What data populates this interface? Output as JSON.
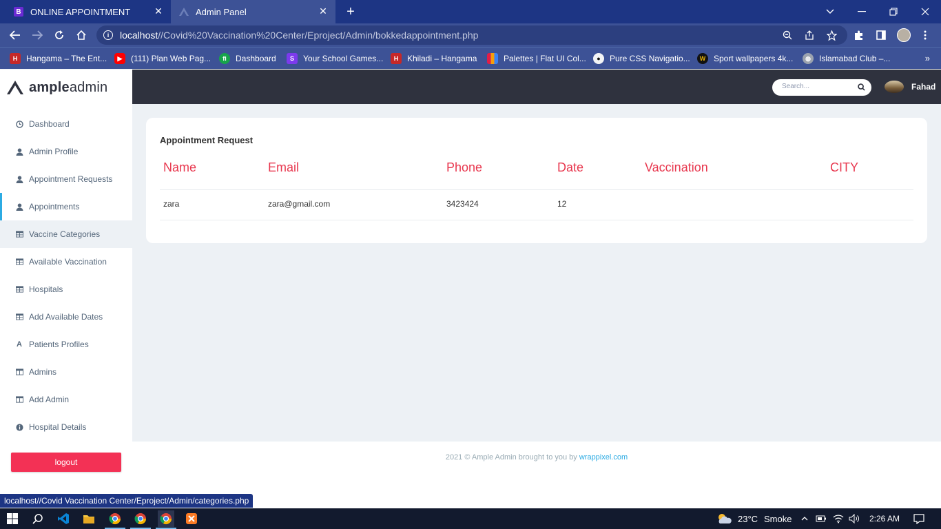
{
  "browser": {
    "tabs": [
      {
        "title": "ONLINE APPOINTMENT",
        "favicon": "B"
      },
      {
        "title": "Admin Panel"
      }
    ],
    "url_host": "localhost",
    "url_path": "//Covid%20Vaccination%20Center/Eproject/Admin/bokkedappointment.php",
    "bookmarks": [
      {
        "label": "Hangama – The Ent...",
        "icon": "hangama-icon",
        "color": "#c62828"
      },
      {
        "label": "(111) Plan Web Pag...",
        "icon": "youtube-icon",
        "color": "#ff0000"
      },
      {
        "label": "Dashboard",
        "icon": "fi-icon",
        "color": "#16a34a"
      },
      {
        "label": "Your School Games...",
        "icon": "school-games-icon",
        "color": "#7c3aed"
      },
      {
        "label": "Khiladi – Hangama",
        "icon": "hangama-icon",
        "color": "#c62828"
      },
      {
        "label": "Palettes | Flat UI Col...",
        "icon": "palette-icon",
        "color": "#e11d48"
      },
      {
        "label": "Pure CSS Navigatio...",
        "icon": "css-icon",
        "color": "#f3f4f6"
      },
      {
        "label": "Sport wallpapers 4k...",
        "icon": "wallpaper-icon",
        "color": "#eab308"
      },
      {
        "label": "Islamabad Club –...",
        "icon": "globe-icon",
        "color": "#9ca3af"
      }
    ],
    "status_url": "localhost//Covid Vaccination Center/Eproject/Admin/categories.php"
  },
  "app": {
    "logo_bold": "ample",
    "logo_light": "admin",
    "search_placeholder": "Search...",
    "user_name": "Fahad",
    "nav": [
      {
        "label": "Dashboard",
        "icon": "clock-icon"
      },
      {
        "label": "Admin Profile",
        "icon": "user-icon"
      },
      {
        "label": "Appointment Requests",
        "icon": "user-icon"
      },
      {
        "label": "Appointments",
        "icon": "user-icon",
        "active": true
      },
      {
        "label": "Vaccine Categories",
        "icon": "table-icon",
        "hover": true
      },
      {
        "label": "Available Vaccination",
        "icon": "table-icon"
      },
      {
        "label": "Hospitals",
        "icon": "table-icon"
      },
      {
        "label": "Add Available Dates",
        "icon": "table-icon"
      },
      {
        "label": "Patients Profiles",
        "icon": "font-icon"
      },
      {
        "label": "Admins",
        "icon": "columns-icon"
      },
      {
        "label": "Add Admin",
        "icon": "columns-icon"
      },
      {
        "label": "Hospital Details",
        "icon": "info-icon"
      }
    ],
    "logout_label": "logout"
  },
  "main": {
    "card_title": "Appointment Request",
    "columns": [
      "Name",
      "Email",
      "Phone",
      "Date",
      "Vaccination",
      "CITY"
    ],
    "rows": [
      [
        "zara",
        "zara@gmail.com",
        "3423424",
        "12",
        "",
        ""
      ]
    ]
  },
  "footer": {
    "text": "2021 © Ample Admin brought to you by ",
    "link": "wrappixel.com"
  },
  "taskbar": {
    "weather": "23°C",
    "condition": "Smoke",
    "time": "2:26 AM"
  },
  "colors": {
    "accent_red": "#e8384f",
    "logout_red": "#f33155",
    "active_blue": "#2cabe3",
    "topbar_dark": "#2f323e",
    "chrome_blue": "#1d3584"
  }
}
